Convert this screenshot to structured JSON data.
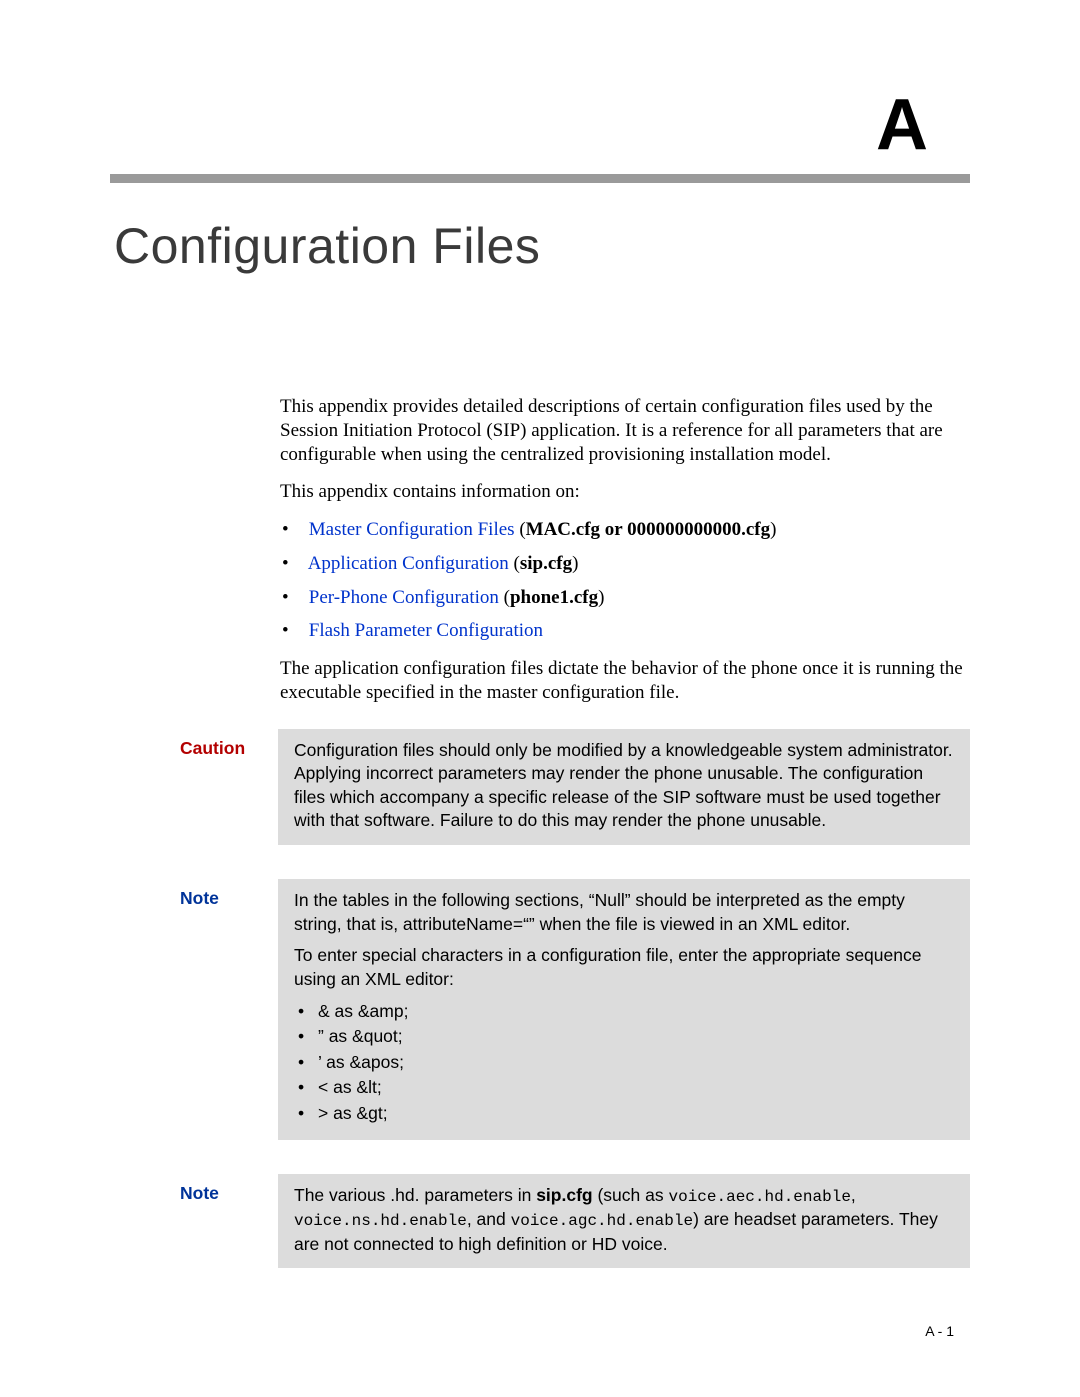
{
  "appendix": {
    "letter": "A"
  },
  "title": "Configuration Files",
  "intro": {
    "p1": "This appendix provides detailed descriptions of certain configuration files used by the Session Initiation Protocol (SIP) application. It is a reference for all parameters that are configurable when using the centralized provisioning installation model.",
    "p2": "This appendix contains information on:"
  },
  "toc": {
    "items": [
      {
        "link": "Master Configuration Files",
        "suffix_prefix": " (",
        "suffix_bold": "MAC.cfg or 000000000000.cfg",
        "suffix_close": ")"
      },
      {
        "link": "Application Configuration",
        "suffix_prefix": " (",
        "suffix_bold": "sip.cfg",
        "suffix_close": ")"
      },
      {
        "link": "Per-Phone Configuration",
        "suffix_prefix": " (",
        "suffix_bold": "phone1.cfg",
        "suffix_close": ")"
      },
      {
        "link": "Flash Parameter Configuration",
        "suffix_prefix": "",
        "suffix_bold": "",
        "suffix_close": ""
      }
    ]
  },
  "body": {
    "p3": "The application configuration files dictate the behavior of the phone once it is running the executable specified in the master configuration file."
  },
  "callouts": {
    "caution": {
      "label": "Caution",
      "text": "Configuration files should only be modified by a knowledgeable system administrator. Applying incorrect parameters may render the phone unusable. The configuration files which accompany a specific release of the SIP software must be used together with that software. Failure to do this may render the phone unusable."
    },
    "note1": {
      "label": "Note",
      "p1": "In the tables in the following sections, “Null” should be interpreted as the empty string, that is, attributeName=“” when the file is viewed in an XML editor.",
      "p2": "To enter special characters in a configuration file, enter the appropriate sequence using an XML editor:",
      "entities": [
        "& as &amp;",
        "” as &quot;",
        "’ as &apos;",
        "< as &lt;",
        "> as &gt;"
      ]
    },
    "note2": {
      "label": "Note",
      "pre": "The various .hd. parameters in ",
      "bold1": "sip.cfg",
      "mid1": " (such as ",
      "code1": "voice.aec.hd.enable",
      "mid2": ", ",
      "code2": "voice.ns.hd.enable",
      "mid3": ", and ",
      "code3": "voice.agc.hd.enable",
      "post": ") are headset parameters. They are not connected to high definition or HD voice."
    }
  },
  "footer": {
    "page_number": "A - 1"
  }
}
